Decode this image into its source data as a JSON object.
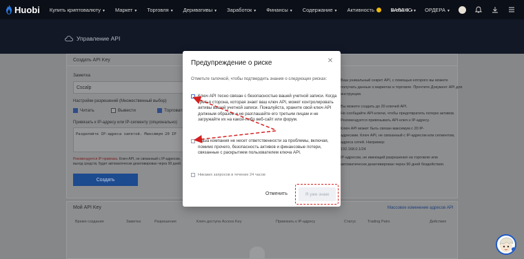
{
  "nav": {
    "logo": "Huobi",
    "items": [
      {
        "label": "Купить криптовалюту",
        "caret": true
      },
      {
        "label": "Маркет",
        "caret": true
      },
      {
        "label": "Торговля",
        "caret": true
      },
      {
        "label": "Деривативы",
        "caret": true
      },
      {
        "label": "Заработок",
        "caret": true
      },
      {
        "label": "Финансы",
        "caret": true
      },
      {
        "label": "Содержание",
        "caret": true
      },
      {
        "label": "Активность",
        "caret": false
      },
      {
        "label": "Web3.0",
        "caret": true
      }
    ],
    "right": {
      "balance": "БАЛАНС",
      "orders": "ОРДЕРА"
    }
  },
  "header": {
    "title": "Управление API"
  },
  "create_panel": {
    "title": "Создать API Key",
    "note_label": "Заметка",
    "note_value": "Cscalp",
    "perm_label": "Настройки разрешений (Множественный выбор)",
    "perm_read": "Читать",
    "perm_withdraw": "Вывести",
    "perm_trade": "Торговать",
    "ip_label": "Привязать к IP-адресу или IP-сегменту (опционально)",
    "ip_placeholder": "Разделяйте IP-адреса запятой. Максимум 20 IP",
    "ip_warn": "Рекомендуется IP-привязка.",
    "ip_warn_rest": "Ключ API, не связанный с IP-адресом,",
    "ip_warn_line2": "выход средств, будет автоматически деактивирован через 90 дней.",
    "create_button": "Создать",
    "right_notes": [
      "Ваш уникальный секрет API, с помощью которого вы можете",
      "получать данные о маркетах и торговле. Прочтите Документ API для",
      "инструкции.",
      "Вы можете создать до 20 ключей API.",
      "Не сообщайте API-ключи, чтобы предотвратить потерю активов.",
      "Рекомендуется привязывать API-ключ к IP-адресу.",
      "Ключ API может быть связан максимум с 20 IP-",
      "адресами. Ключ API, не связанный с IP-адресом или сегментом,",
      "адреса сетей. Например:",
      "192.168.0.1/24",
      "IP-адресом, не имеющий разрешения на торговлю или",
      "автоматически деактивирован через 90 дней бездействия."
    ]
  },
  "keys_panel": {
    "title": "Мой API Key",
    "link": "Массовое изменение адресов API",
    "columns": [
      "Время создания",
      "Заметка",
      "Разрешения",
      "Ключ доступа Access Key",
      "Привязать к IP-адресу",
      "Статус",
      "Trading Pairs",
      "Действия"
    ]
  },
  "modal": {
    "title": "Предупреждение о риске",
    "intro": "Отметьте галочкой, чтобы подтвердить знания о следующих рисках:",
    "item1": "Ключ API тесно связан с безопасностью вашей учетной записи. Когда третья сторона, которая знает ваш ключ API, может контролировать активы вашей учетной записи. Пожалуйста, храните свой ключ API должным образом и не разглашайте его третьим лицам и не загружайте их на какой-либо веб-сайт или форум.",
    "item2": "Наша компания не несет ответственности за проблемы, включая, помимо прочего, безопасность активов и финансовые потери, связанные с раскрытием пользователем ключа API.",
    "item3": "Никаких запросов в течение 24 часов",
    "cancel": "Отменить",
    "confirm": "Я уже знаю"
  },
  "colors": {
    "annotation": "#d51f1f",
    "nav_bg": "#0b0f17",
    "create_btn": "#1d4b8f"
  }
}
